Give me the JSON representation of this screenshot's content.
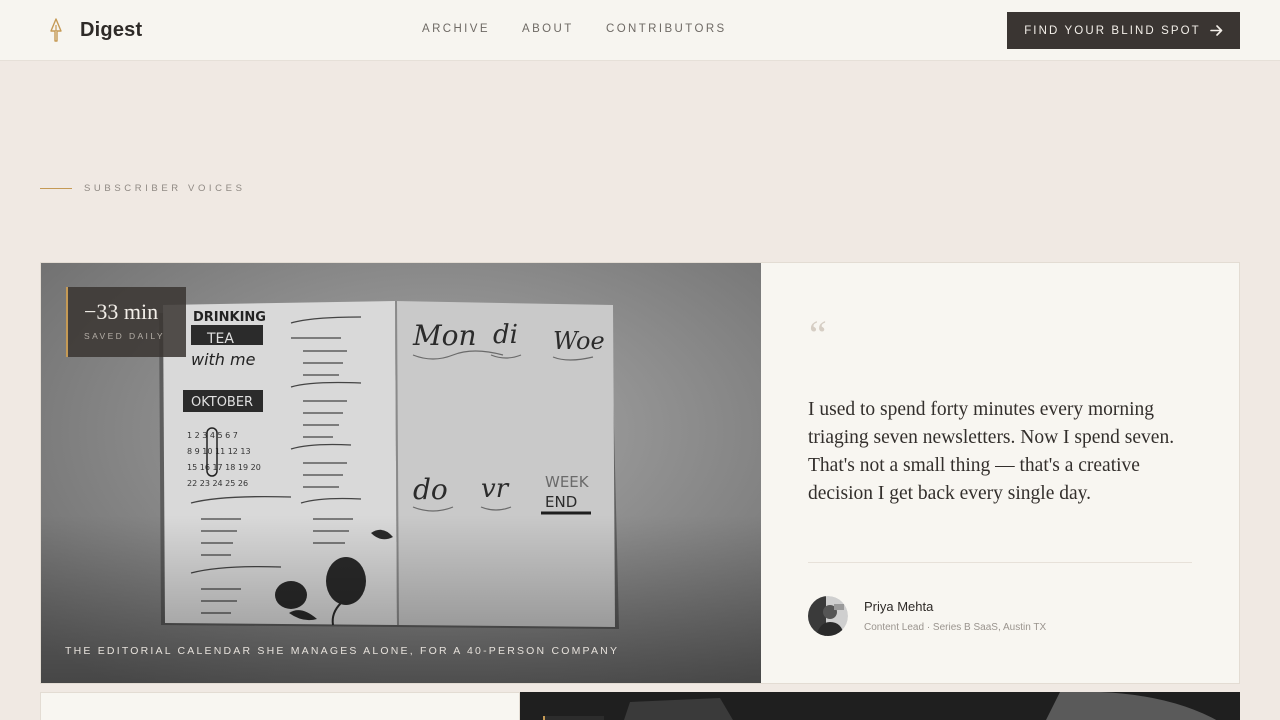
{
  "header": {
    "brand": {
      "name": "Digest",
      "icon": "quill-nib-icon",
      "accent": "#c59a55"
    },
    "nav": [
      {
        "label": "ARCHIVE"
      },
      {
        "label": "ABOUT"
      },
      {
        "label": "CONTRIBUTORS"
      }
    ],
    "cta": {
      "label": "FIND YOUR BLIND SPOT",
      "icon": "arrow-right-icon",
      "background": "#3a3532"
    }
  },
  "section": {
    "eyebrow": "SUBSCRIBER VOICES"
  },
  "testimonial": {
    "photo": {
      "description_icon": "bullet-journal-photo",
      "stat_value": "−33 min",
      "stat_label": "SAVED DAILY",
      "caption": "THE EDITORIAL CALENDAR SHE MANAGES ALONE, FOR A 40-PERSON COMPANY"
    },
    "quote_mark": "“",
    "quote": "I used to spend forty minutes every morning triaging seven newsletters. Now I spend seven. That's not a small thing — that's a creative decision I get back every single day.",
    "author": {
      "name": "Priya Mehta",
      "role": "Content Lead · Series B SaaS, Austin TX",
      "avatar_icon": "avatar-photo"
    }
  },
  "colors": {
    "page_background": "#f0e9e3",
    "header_background": "#f7f5f0",
    "accent": "#c59a55",
    "dark": "#3a3532"
  }
}
